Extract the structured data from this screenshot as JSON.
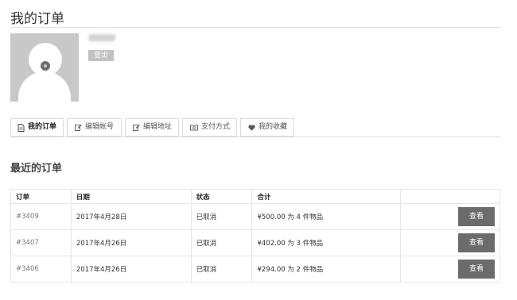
{
  "page": {
    "title": "我的订单"
  },
  "account": {
    "logout_label": "登出"
  },
  "tabs": [
    {
      "label": "我的订单",
      "icon": "document-icon",
      "active": true
    },
    {
      "label": "编辑帐号",
      "icon": "edit-icon",
      "active": false
    },
    {
      "label": "编辑地址",
      "icon": "edit-icon",
      "active": false
    },
    {
      "label": "支付方式",
      "icon": "money-icon",
      "active": false
    },
    {
      "label": "我的收藏",
      "icon": "heart-icon",
      "active": false
    }
  ],
  "recent": {
    "title": "最近的订单",
    "columns": [
      "订单",
      "日期",
      "状态",
      "合计",
      ""
    ],
    "rows": [
      {
        "order": "#3409",
        "date": "2017年4月28日",
        "status": "已取消",
        "total": "¥500.00 为 4 件物品",
        "action": "查看"
      },
      {
        "order": "#3407",
        "date": "2017年4月26日",
        "status": "已取消",
        "total": "¥402.00 为 3 件物品",
        "action": "查看"
      },
      {
        "order": "#3406",
        "date": "2017年4月26日",
        "status": "已取消",
        "total": "¥294.00 为 2 件物品",
        "action": "查看"
      }
    ]
  },
  "colors": {
    "button_bg": "#6b6b6b",
    "logout_bg": "#c2c2c2",
    "border": "#dcdcdc"
  }
}
